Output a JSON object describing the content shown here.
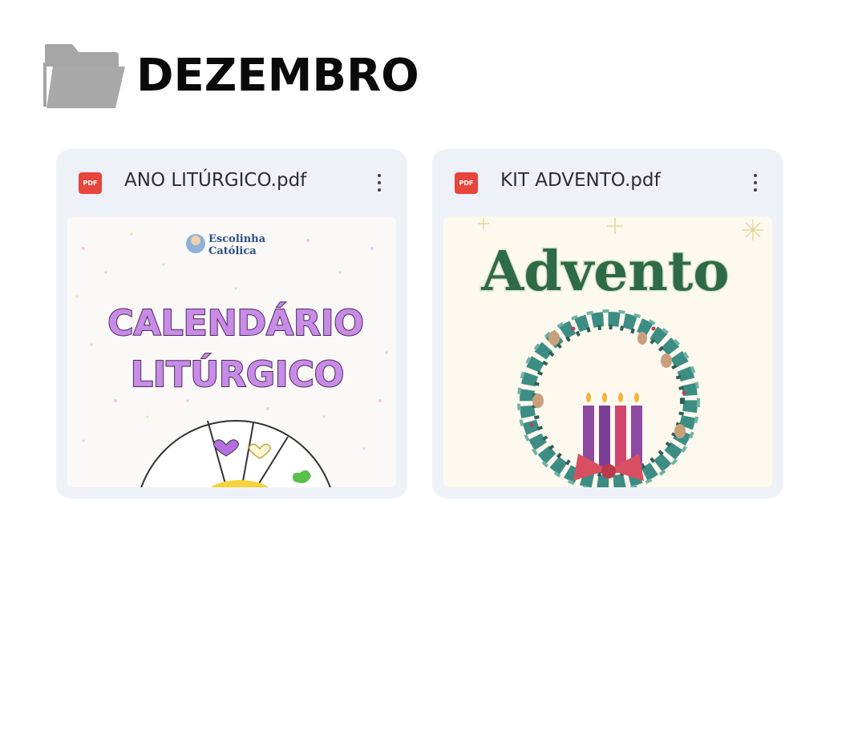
{
  "folder": {
    "icon": "folder-icon",
    "title": "DEZEMBRO"
  },
  "files": [
    {
      "name": "ANO LITÚRGICO.pdf",
      "type_icon": "pdf-icon",
      "type_label": "PDF",
      "menu_icon": "more-vert-icon",
      "thumbnail": {
        "logo_line1": "Escolinha",
        "logo_line2": "Católica",
        "title_line1": "CALENDÁRIO",
        "title_line2": "LITÚRGICO"
      }
    },
    {
      "name": "KIT ADVENTO.pdf",
      "type_icon": "pdf-icon",
      "type_label": "PDF",
      "menu_icon": "more-vert-icon",
      "thumbnail": {
        "title": "Advento"
      }
    }
  ],
  "colors": {
    "card_bg": "#eef2f8",
    "pdf_red": "#e8453c",
    "folder_grey": "#a9a9a9",
    "calendar_purple": "#c88be6",
    "advento_green": "#2e6a45"
  }
}
